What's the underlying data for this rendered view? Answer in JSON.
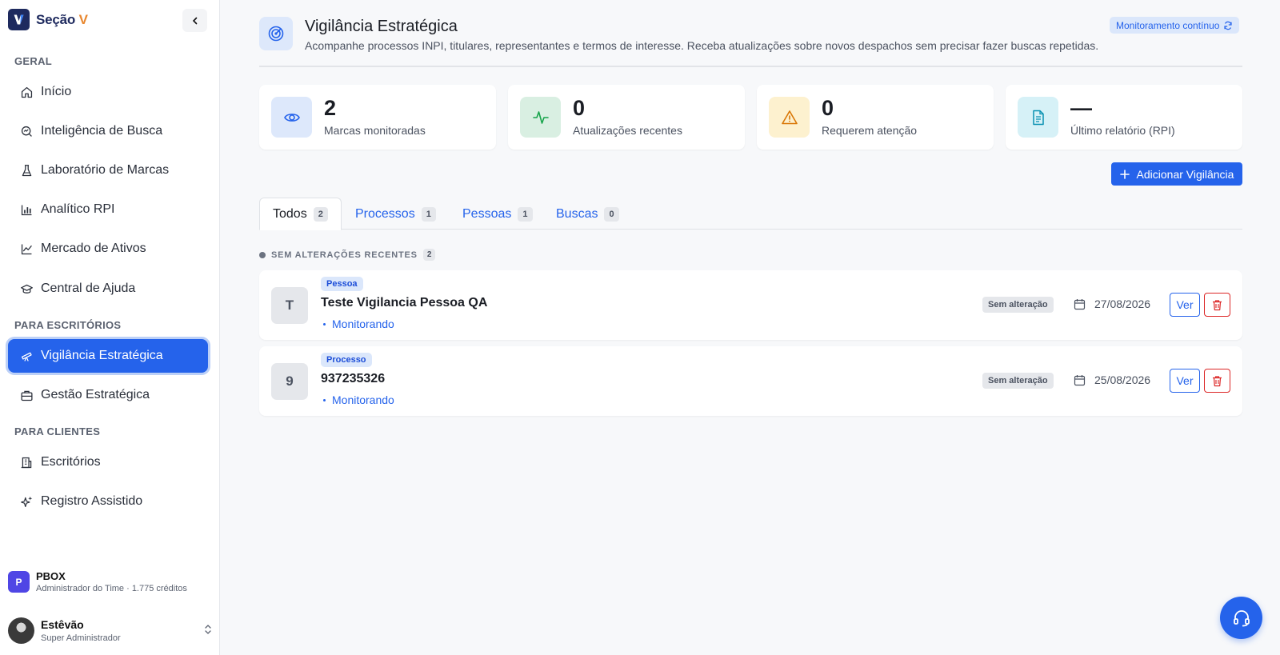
{
  "brand": {
    "name": "Seção",
    "accent": "V"
  },
  "sidebar": {
    "sections": {
      "geral": "GERAL",
      "escritorios": "PARA ESCRITÓRIOS",
      "clientes": "PARA CLIENTES"
    },
    "items": [
      {
        "label": "Início",
        "icon": "home-icon"
      },
      {
        "label": "Inteligência de Busca",
        "icon": "search-analytics-icon"
      },
      {
        "label": "Laboratório de Marcas",
        "icon": "flask-icon"
      },
      {
        "label": "Analítico RPI",
        "icon": "bar-chart-icon"
      },
      {
        "label": "Mercado de Ativos",
        "icon": "line-chart-icon"
      },
      {
        "label": "Central de Ajuda",
        "icon": "graduation-cap-icon"
      },
      {
        "label": "Vigilância Estratégica",
        "icon": "telescope-icon",
        "active": true
      },
      {
        "label": "Gestão Estratégica",
        "icon": "briefcase-icon"
      },
      {
        "label": "Escritórios",
        "icon": "building-icon"
      },
      {
        "label": "Registro Assistido",
        "icon": "sparkles-icon"
      }
    ],
    "org": {
      "initial": "P",
      "name": "PBOX",
      "subtitle": "Administrador do Time · 1.775 créditos"
    },
    "user": {
      "name": "Estêvão",
      "role": "Super Administrador"
    }
  },
  "header": {
    "title": "Vigilância Estratégica",
    "subtitle": "Acompanhe processos INPI, titulares, representantes e termos de interesse. Receba atualizações sobre novos despachos sem precisar fazer buscas repetidas.",
    "badge": "Monitoramento contínuo"
  },
  "stats": [
    {
      "value": "2",
      "label": "Marcas monitoradas",
      "icon": "eye-icon",
      "color": "#2563eb",
      "bg": "#dde8fb"
    },
    {
      "value": "0",
      "label": "Atualizações recentes",
      "icon": "activity-icon",
      "color": "#16a34a",
      "bg": "#d9efe2"
    },
    {
      "value": "0",
      "label": "Requerem atenção",
      "icon": "alert-triangle-icon",
      "color": "#d97706",
      "bg": "#fdf1cf"
    },
    {
      "value": "—",
      "label": "Último relatório (RPI)",
      "icon": "document-icon",
      "color": "#0891b2",
      "bg": "#d6f1f7"
    }
  ],
  "add_button": "Adicionar Vigilância",
  "tabs": [
    {
      "label": "Todos",
      "count": "2",
      "active": true
    },
    {
      "label": "Processos",
      "count": "1"
    },
    {
      "label": "Pessoas",
      "count": "1"
    },
    {
      "label": "Buscas",
      "count": "0"
    }
  ],
  "group": {
    "label": "SEM ALTERAÇÕES RECENTES",
    "count": "2"
  },
  "items": [
    {
      "initial": "T",
      "type": "Pessoa",
      "title": "Teste Vigilancia Pessoa QA",
      "status": "Monitorando",
      "change": "Sem alteração",
      "date": "27/08/2026",
      "view": "Ver"
    },
    {
      "initial": "9",
      "type": "Processo",
      "title": "937235326",
      "status": "Monitorando",
      "change": "Sem alteração",
      "date": "25/08/2026",
      "view": "Ver"
    }
  ],
  "colors": {
    "primary": "#2563eb",
    "danger": "#dc2626",
    "brand_dark": "#1e2a5e",
    "brand_accent": "#e8872f"
  }
}
